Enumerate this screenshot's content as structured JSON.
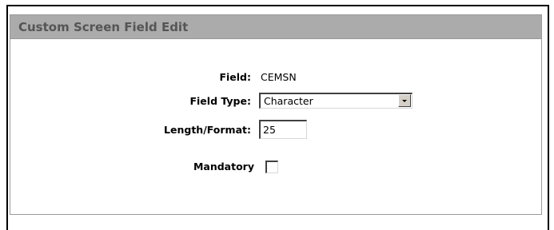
{
  "panel": {
    "title": "Custom Screen Field Edit"
  },
  "form": {
    "field_label": "Field:",
    "field_value": "CEMSN",
    "field_type_label": "Field Type:",
    "field_type_value": "Character",
    "length_format_label": "Length/Format:",
    "length_format_value": "25",
    "mandatory_label": "Mandatory",
    "mandatory_checked": false
  },
  "icons": {
    "dropdown": "chevron-down-icon"
  }
}
